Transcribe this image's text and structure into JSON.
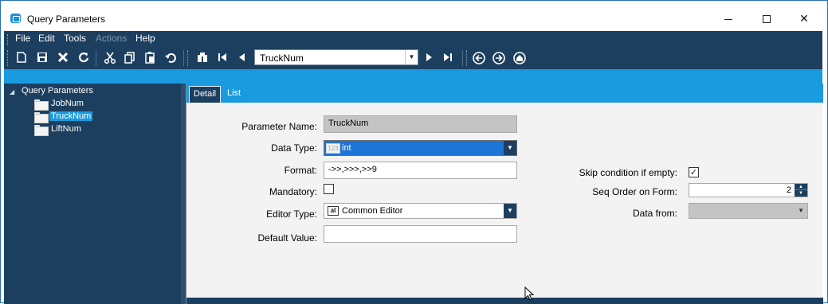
{
  "window": {
    "title": "Query Parameters",
    "minimize": "—",
    "maximize": "☐",
    "close": "✕"
  },
  "menu": {
    "items": [
      {
        "label": "File",
        "enabled": true
      },
      {
        "label": "Edit",
        "enabled": true
      },
      {
        "label": "Tools",
        "enabled": true
      },
      {
        "label": "Actions",
        "enabled": false
      },
      {
        "label": "Help",
        "enabled": true
      }
    ]
  },
  "toolbar": {
    "icons": [
      "new-icon",
      "save-icon",
      "delete-icon",
      "refresh-icon",
      "cut-icon",
      "copy-icon",
      "paste-icon",
      "undo-icon",
      "find-icon",
      "first-record-icon",
      "previous-record-icon",
      "next-record-icon",
      "last-record-icon",
      "back-icon",
      "forward-icon",
      "home-icon"
    ],
    "field_selector_value": "TruckNum"
  },
  "tree": {
    "root": "Query Parameters",
    "children": [
      {
        "label": "JobNum",
        "selected": false
      },
      {
        "label": "TruckNum",
        "selected": true
      },
      {
        "label": "LiftNum",
        "selected": false
      }
    ]
  },
  "tabs": {
    "detail": "Detail",
    "list": "List"
  },
  "form": {
    "parameter_name_label": "Parameter Name:",
    "parameter_name_value": "TruckNum",
    "data_type_label": "Data Type:",
    "data_type_value": "int",
    "format_label": "Format:",
    "format_value": "->>,>>>,>>9",
    "mandatory_label": "Mandatory:",
    "mandatory_checked": false,
    "editor_type_label": "Editor Type:",
    "editor_type_value": "Common Editor",
    "default_value_label": "Default Value:",
    "default_value_value": "",
    "skip_condition_label": "Skip condition if empty:",
    "skip_condition_checked": true,
    "seq_order_label": "Seq Order on Form:",
    "seq_order_value": "2",
    "data_from_label": "Data from:",
    "data_from_value": ""
  },
  "colors": {
    "navy": "#1d3f5f",
    "accent_blue": "#1a9be0",
    "selection_blue": "#1c74d6"
  }
}
